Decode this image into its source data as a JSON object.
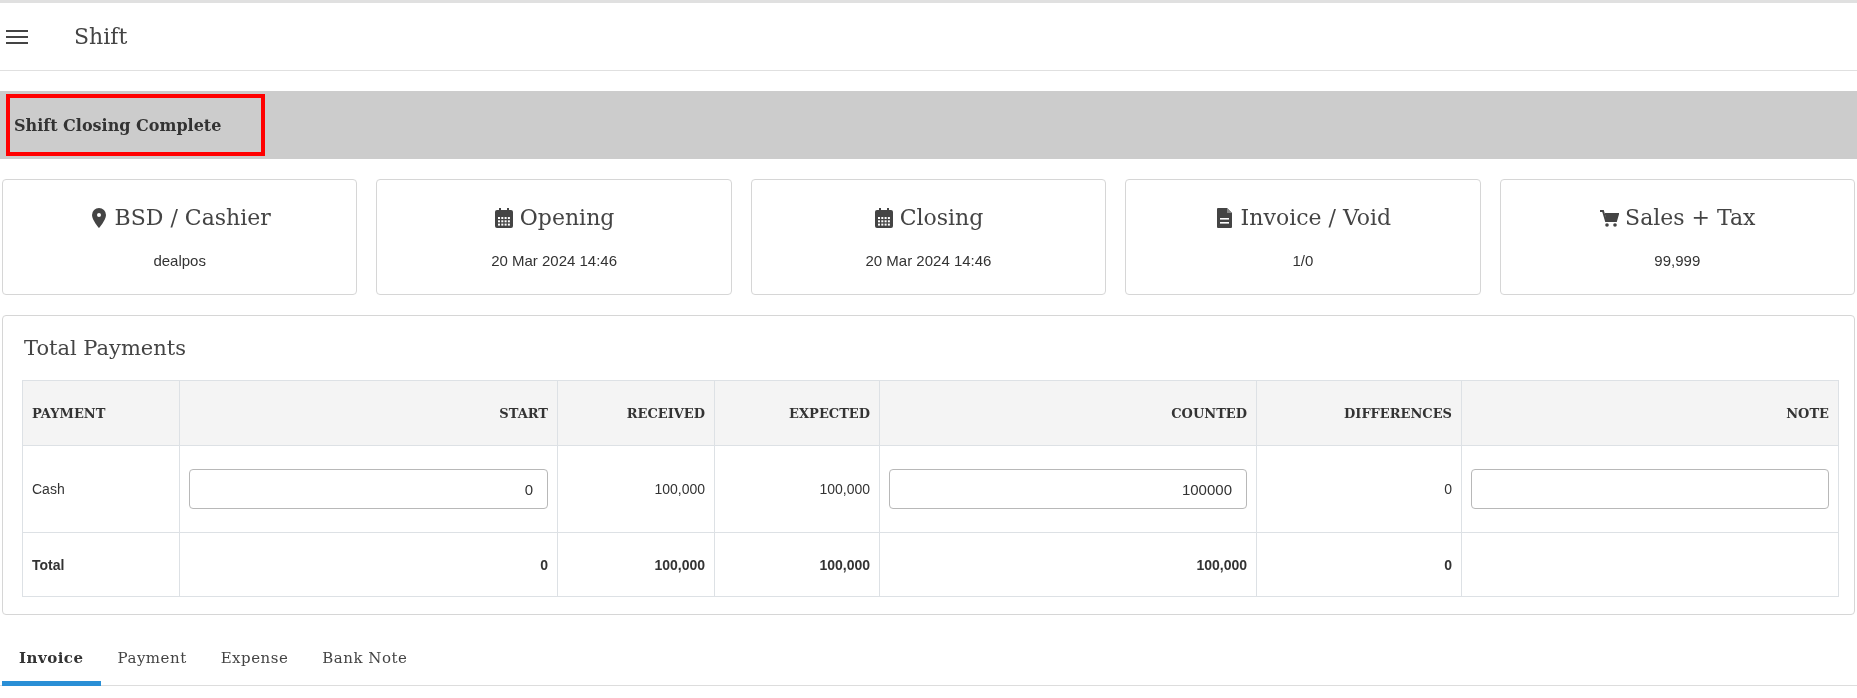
{
  "header": {
    "title": "Shift"
  },
  "banner": {
    "title": "Shift Closing Complete",
    "highlighted": true
  },
  "cards": [
    {
      "kind": "pin",
      "title": "BSD / Cashier",
      "value": "dealpos"
    },
    {
      "kind": "calendar",
      "title": "Opening",
      "value": "20 Mar 2024 14:46"
    },
    {
      "kind": "calendar",
      "title": "Closing",
      "value": "20 Mar 2024 14:46"
    },
    {
      "kind": "file",
      "title": "Invoice / Void",
      "value": "1/0"
    },
    {
      "kind": "cart",
      "title": "Sales + Tax",
      "value": "99,999"
    }
  ],
  "payments": {
    "title": "Total Payments",
    "columns": [
      "PAYMENT",
      "START",
      "RECEIVED",
      "EXPECTED",
      "COUNTED",
      "DIFFERENCES",
      "NOTE"
    ],
    "rows": [
      {
        "kind": "entry",
        "cells": [
          {
            "kind": "text",
            "text": "Cash"
          },
          {
            "kind": "input",
            "value": "0"
          },
          {
            "kind": "text",
            "text": "100,000"
          },
          {
            "kind": "text",
            "text": "100,000"
          },
          {
            "kind": "input",
            "value": "100000"
          },
          {
            "kind": "text",
            "text": "0"
          },
          {
            "kind": "input"
          }
        ]
      },
      {
        "kind": "total",
        "cells": [
          {
            "kind": "text",
            "text": "Total"
          },
          {
            "kind": "text",
            "text": "0"
          },
          {
            "kind": "text",
            "text": "100,000"
          },
          {
            "kind": "text",
            "text": "100,000"
          },
          {
            "kind": "text",
            "text": "100,000"
          },
          {
            "kind": "text",
            "text": "0"
          },
          {
            "kind": "empty"
          }
        ]
      }
    ]
  },
  "tabs": [
    {
      "label": "Invoice",
      "selected": true
    },
    {
      "label": "Payment",
      "selected": false
    },
    {
      "label": "Expense",
      "selected": false
    },
    {
      "label": "Bank Note",
      "selected": false
    }
  ]
}
